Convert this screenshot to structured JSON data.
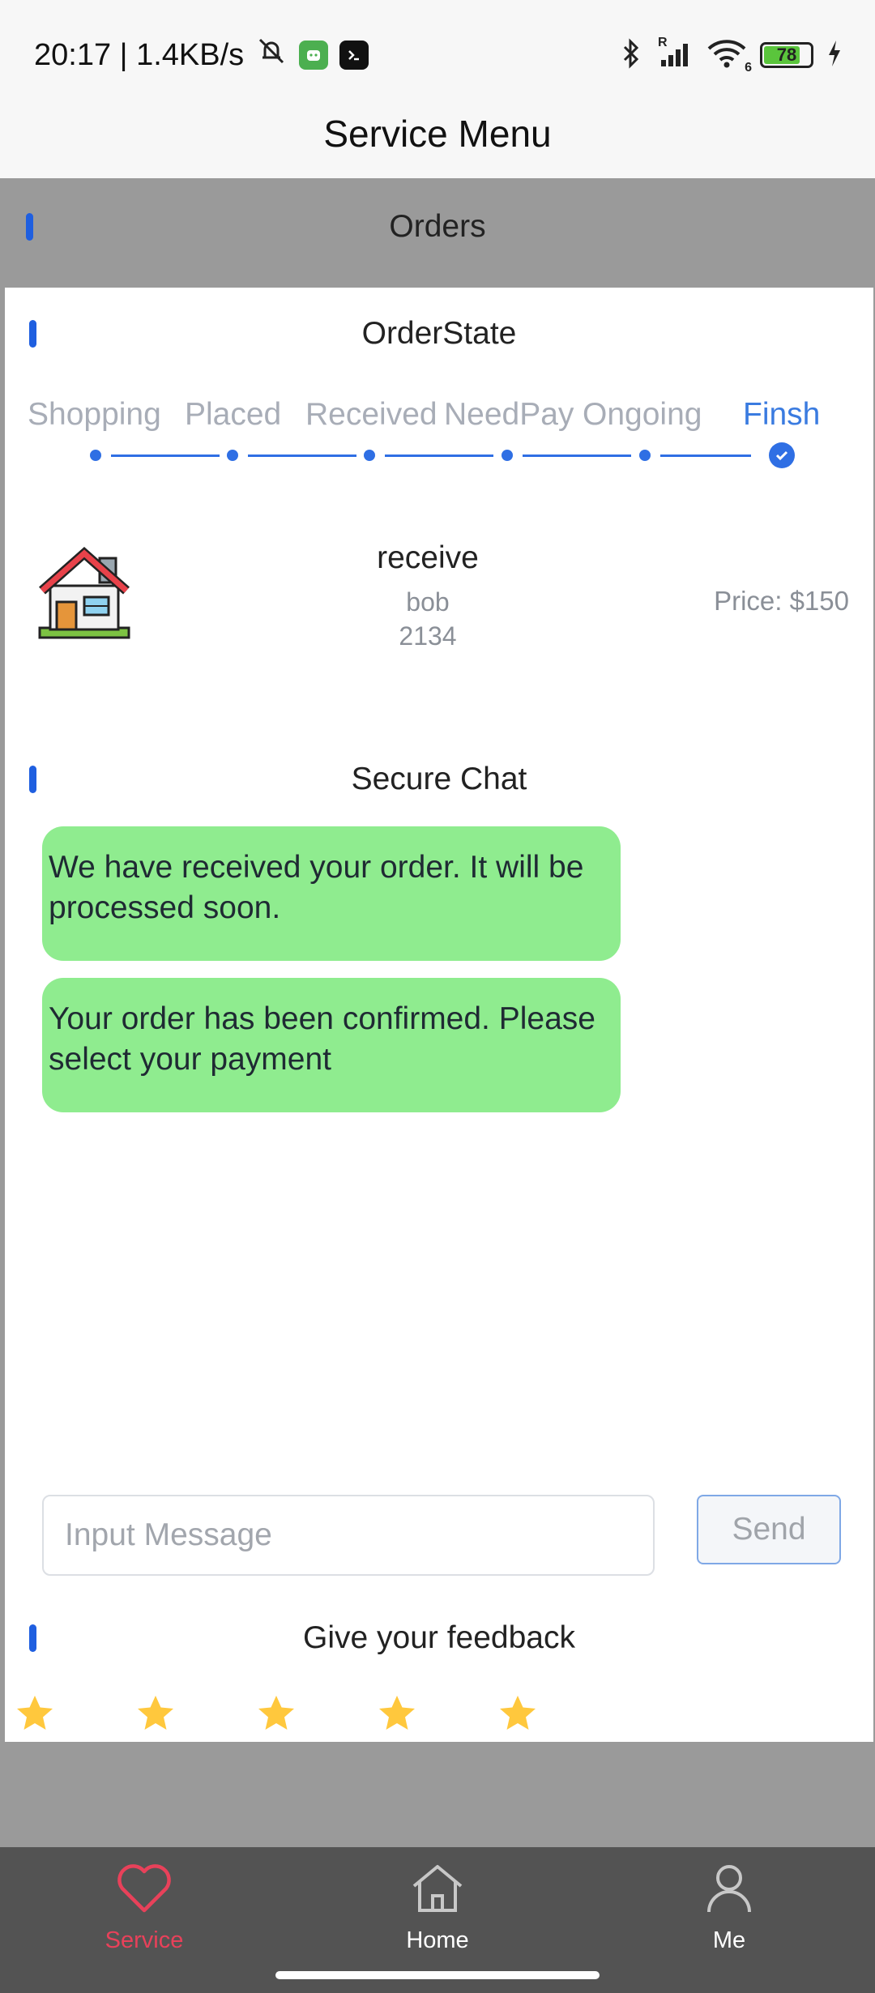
{
  "status_bar": {
    "time_speed": "20:17 | 1.4KB/s",
    "signal_label": "R",
    "wifi_label": "6",
    "battery": "78",
    "battery_level": 0.78
  },
  "header": {
    "title": "Service Menu"
  },
  "orders_header": "Orders",
  "order_state": {
    "title": "OrderState",
    "steps": [
      {
        "label": "Shopping"
      },
      {
        "label": "Placed"
      },
      {
        "label": "Received"
      },
      {
        "label": "NeedPay"
      },
      {
        "label": "Ongoing"
      },
      {
        "label": "Finsh"
      }
    ],
    "active_step": "Finsh"
  },
  "order": {
    "icon": "house-icon",
    "title": "receive",
    "customer": "bob",
    "number": "2134",
    "price": "Price: $150"
  },
  "chat": {
    "title": "Secure Chat",
    "messages": [
      {
        "text": "We have received your order. It will be processed soon."
      },
      {
        "text": "Your order has been confirmed. Please select your payment"
      }
    ],
    "bubble_color": "#8fec8f",
    "input_placeholder": "Input Message",
    "input_value": "",
    "send_label": "Send"
  },
  "feedback": {
    "title": "Give your feedback",
    "rating_max": 5,
    "rating": 5,
    "star_color": "#ffc83d"
  },
  "nav": {
    "items": [
      {
        "label": "Service",
        "icon": "heart-icon",
        "active": true
      },
      {
        "label": "Home",
        "icon": "home-icon",
        "active": false
      },
      {
        "label": "Me",
        "icon": "person-icon",
        "active": false
      }
    ],
    "active_color": "#e8415a"
  },
  "colors": {
    "accent": "#2f6fe4",
    "frame_gray": "#9a9a9a",
    "nav_bg": "#535353"
  }
}
